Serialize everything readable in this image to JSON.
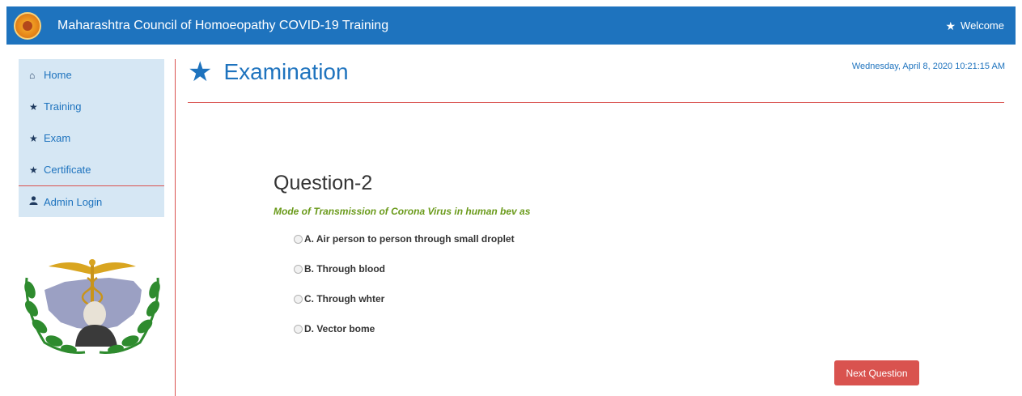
{
  "header": {
    "title": "Maharashtra Council of Homoeopathy COVID-19 Training",
    "welcome_label": "Welcome",
    "logo_icon": "emblem-seal-icon",
    "bg_color": "#1e73be"
  },
  "sidebar": {
    "items": [
      {
        "label": "Home",
        "icon": "home-icon"
      },
      {
        "label": "Training",
        "icon": "star-icon"
      },
      {
        "label": "Exam",
        "icon": "star-icon"
      },
      {
        "label": "Certificate",
        "icon": "star-icon"
      },
      {
        "label": "Admin Login",
        "icon": "user-icon"
      }
    ]
  },
  "main": {
    "page_title": "Examination",
    "datetime": "Wednesday, April 8, 2020 10:21:15 AM",
    "question": {
      "number_label": "Question-2",
      "text": "Mode of Transmission of Corona Virus in human bev as",
      "options": [
        "A. Air person to person through small droplet",
        "B. Through blood",
        "C. Through whter",
        "D. Vector bome"
      ]
    },
    "next_button_label": "Next Question"
  },
  "colors": {
    "accent": "#1e73be",
    "danger": "#d9534f",
    "question_text": "#6a9a1a",
    "sidebar_bg": "#d6e7f4"
  }
}
